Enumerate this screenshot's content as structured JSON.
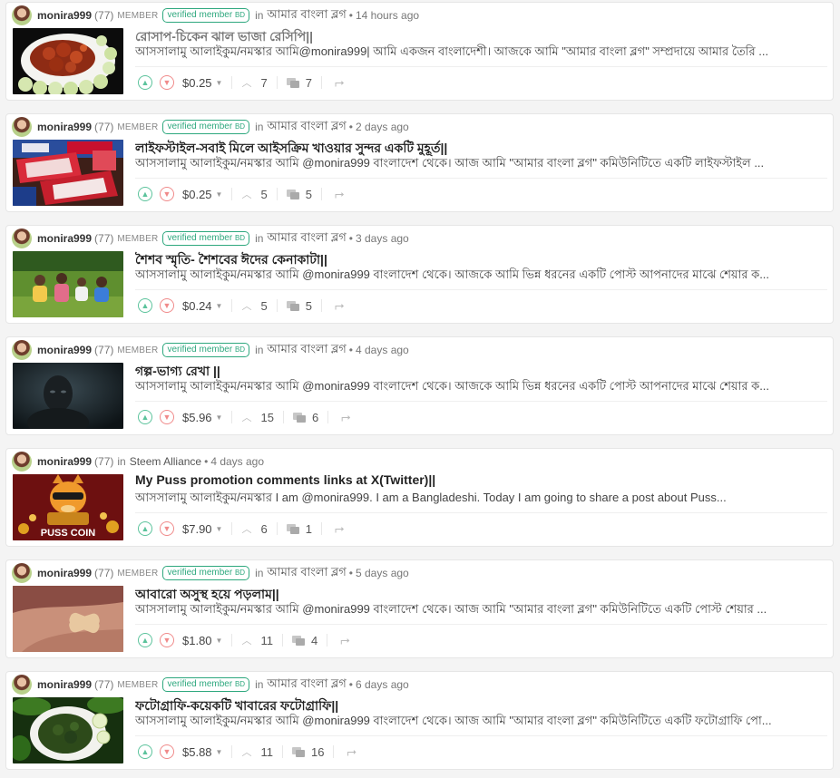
{
  "posts": [
    {
      "author": "monira999",
      "reputation": "(77)",
      "member_label": "MEMBER",
      "badge": "verified member",
      "badge_country": "BD",
      "in_word": "in",
      "community": "আমার বাংলা ব্লগ",
      "time": "14 hours ago",
      "title": "রোসাপ-চিকেন ঝাল ভাজা রেসিপি||",
      "title_style": "faded",
      "excerpt": "আসসালামু আলাইকুম/নমস্কার আমি@monira999| আমি একজন বাংলাদেশী। আজকে আমি \"আমার বাংলা ব্লগ\" সম্প্রদায়ে আমার তৈরি ...",
      "payout": "$0.25",
      "votes": "7",
      "comments": "7",
      "thumb": "food-chicken"
    },
    {
      "author": "monira999",
      "reputation": "(77)",
      "member_label": "MEMBER",
      "badge": "verified member",
      "badge_country": "BD",
      "in_word": "in",
      "community": "আমার বাংলা ব্লগ",
      "time": "2 days ago",
      "title": "লাইফস্টাইল-সবাই মিলে আইসক্রিম খাওয়ার সুন্দর একটি মুহূর্ত||",
      "title_style": "normal",
      "excerpt": "আসসালামু আলাইকুম/নমস্কার আমি @monira999 বাংলাদেশ থেকে। আজ আমি \"আমার বাংলা ব্লগ\" কমিউনিটিতে একটি লাইফস্টাইল ...",
      "payout": "$0.25",
      "votes": "5",
      "comments": "5",
      "thumb": "icecream"
    },
    {
      "author": "monira999",
      "reputation": "(77)",
      "member_label": "MEMBER",
      "badge": "verified member",
      "badge_country": "BD",
      "in_word": "in",
      "community": "আমার বাংলা ব্লগ",
      "time": "3 days ago",
      "title": "শৈশব স্মৃতি- শৈশবের ঈদের কেনাকাটা||",
      "title_style": "normal",
      "excerpt": "আসসালামু আলাইকুম/নমস্কার আমি @monira999 বাংলাদেশ থেকে। আজকে আমি ভিন্ন ধরনের একটি পোস্ট আপনাদের মাঝে শেয়ার ক...",
      "payout": "$0.24",
      "votes": "5",
      "comments": "5",
      "thumb": "children"
    },
    {
      "author": "monira999",
      "reputation": "(77)",
      "member_label": "MEMBER",
      "badge": "verified member",
      "badge_country": "BD",
      "in_word": "in",
      "community": "আমার বাংলা ব্লগ",
      "time": "4 days ago",
      "title": "গল্প-ভাগ্য রেখা ||",
      "title_style": "normal",
      "excerpt": "আসসালামু আলাইকুম/নমস্কার আমি @monira999 বাংলাদেশ থেকে। আজকে আমি ভিন্ন ধরনের একটি পোস্ট আপনাদের মাঝে শেয়ার ক...",
      "payout": "$5.96",
      "votes": "15",
      "comments": "6",
      "thumb": "dark-figure"
    },
    {
      "author": "monira999",
      "reputation": "(77)",
      "member_label": "",
      "badge": "",
      "badge_country": "",
      "in_word": "in",
      "community": "Steem Alliance",
      "time": "4 days ago",
      "title": "My Puss promotion comments links at X(Twitter)||",
      "title_style": "normal",
      "excerpt": "আসসালামু আলাইকুম/নমস্কার I am @monira999. I am a Bangladeshi. Today I am going to share a post about Puss...",
      "payout": "$7.90",
      "votes": "6",
      "comments": "1",
      "thumb": "puss-coin",
      "thumb_text": "PUSS COIN"
    },
    {
      "author": "monira999",
      "reputation": "(77)",
      "member_label": "MEMBER",
      "badge": "verified member",
      "badge_country": "BD",
      "in_word": "in",
      "community": "আমার বাংলা ব্লগ",
      "time": "5 days ago",
      "title": "আবারো অসুস্থ হয়ে পড়লাম||",
      "title_style": "normal",
      "excerpt": "আসসালামু আলাইকুম/নমস্কার আমি @monira999 বাংলাদেশ থেকে। আজ আমি \"আমার বাংলা ব্লগ\" কমিউনিটিতে একটি পোস্ট শেয়ার ...",
      "payout": "$1.80",
      "votes": "11",
      "comments": "4",
      "thumb": "hand-bandage"
    },
    {
      "author": "monira999",
      "reputation": "(77)",
      "member_label": "MEMBER",
      "badge": "verified member",
      "badge_country": "BD",
      "in_word": "in",
      "community": "আমার বাংলা ব্লগ",
      "time": "6 days ago",
      "title": "ফটোগ্রাফি-কয়েকটি খাবারের ফটোগ্রাফি||",
      "title_style": "normal",
      "excerpt": "আসসালামু আলাইকুম/নমস্কার আমি @monira999 বাংলাদেশ থেকে। আজ আমি \"আমার বাংলা ব্লগ\" কমিউনিটিতে একটি ফটোগ্রাফি পো...",
      "payout": "$5.88",
      "votes": "11",
      "comments": "16",
      "thumb": "greens-plate"
    }
  ],
  "icons": {
    "upvote": "chevron-up-circle-icon",
    "downvote": "chevron-down-circle-icon",
    "payout_dropdown": "caret-down-icon",
    "votes": "chevron-up-icon",
    "comments": "comments-icon",
    "reblog": "reblog-icon"
  },
  "colors": {
    "upvote": "#5cc39c",
    "downvote": "#f08a8a",
    "verified": "#2ea87e"
  }
}
